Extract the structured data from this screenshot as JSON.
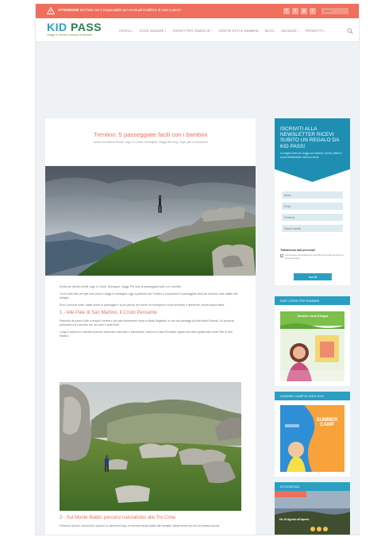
{
  "topbar": {
    "alert_label": "ATTENZIONE",
    "alert_text": "Kid Pass non è responsabile per eventuali modifiche di orari e prezzi",
    "social": [
      "f",
      "t",
      "p",
      "i"
    ],
    "search_placeholder": "Cerca"
  },
  "header": {
    "logo_kid": "KID",
    "logo_pass": "PASS",
    "tagline": "Viaggi & Servizi a misura di bambini",
    "nav": [
      {
        "label": "CERCA",
        "caret": "▾"
      },
      {
        "label": "DOVE ANDARE",
        "caret": "▾"
      },
      {
        "label": "EVENTI PER FAMIGLIE",
        "caret": "▾"
      },
      {
        "label": "CENTRI ESTIVI BAMBINI",
        "caret": ""
      },
      {
        "label": "BLOG",
        "caret": ""
      },
      {
        "label": "VACANZE",
        "caret": "▾"
      },
      {
        "label": "PRODOTTI",
        "caret": "▾"
      }
    ]
  },
  "article": {
    "title": "Trentino: 5 passeggiate facili con i bambini",
    "meta": "Scritto da Valeria Gentili, tags: in Centri, Montagna, Viaggi Nel blog. Tags: gite e escursioni",
    "intro": "Scritto da Valeria Gentili, tags: in Centri, Montagna, Viaggi. Per idee di passeggiate facili con i bambini.",
    "paragraph1": "Tra le varie idee per gite fuori porta e viaggi in montagna, oggi vi parliamo del Trentino e proponiamo 5 passeggiate facili per bambini, tutte adatte alle famiglie.",
    "paragraph1b": "Ecco i percorsi scelti, adatti anche ai passeggini e ai più piccoli, per vivere la montagna in modo semplice e divertente, senza troppa fatica.",
    "section1": "1 - Alle Pale di San Martino, il Cristo Pensante",
    "paragraph2": "Partendo da passo Rolle si segue il sentiero che sale dolcemente verso la Baita Segantini, in uno dei paesaggi più belli delle Dolomiti. Un percorso panoramico di circa due ore tra rocce e prati fioriti.",
    "paragraph2b": "Lungo il cammino i bambini possono osservare marmotte e stambecchi; l'arrivo al Cristo Pensante regala una vista spettacolare sulle Pale di San Martino.",
    "section2": "2 - Sul Monte Baldo: percorsi naturalistici alle Tre Cime",
    "paragraph3": "Partendo da Avio, tra boschi e pascoli, si cammina lungo un sentiero facile adatto alle famiglie. Ideale anche per chi ha bambini piccoli."
  },
  "newsletter": {
    "title": "ISCRIVITI ALLA NEWSLETTER RICEVI SUBITO UN REGALO DA KID PASS!",
    "desc": "Le migliori idee per viaggi con bambini, eventi, offerte e sconti direttamente nella tua email.",
    "fields": [
      "Nome",
      "Email",
      "Provincia",
      "Data di nascita"
    ],
    "privacy_title": "Trattamento dati personali",
    "privacy_text": "Acconsento al trattamento dei dati personali secondo la Privacy Policy.",
    "button": "Iscriviti"
  },
  "widgets": [
    {
      "title": "IDEE CORSI PER BAMBINI"
    },
    {
      "title": "SUMMER CAMP DI KIDS 2019"
    },
    {
      "title": "IN EVIDENZA"
    }
  ],
  "ads": {
    "corsi_banner": "Durante i corsi di lingua",
    "camp_line1": "SUMMER",
    "camp_line2": "CAMP",
    "evidenza_text": "Da 15 Agosto all'aperto"
  },
  "colors": {
    "coral": "#ef6f5c",
    "blue": "#2b9fc2",
    "teal": "#1e8fb3"
  }
}
